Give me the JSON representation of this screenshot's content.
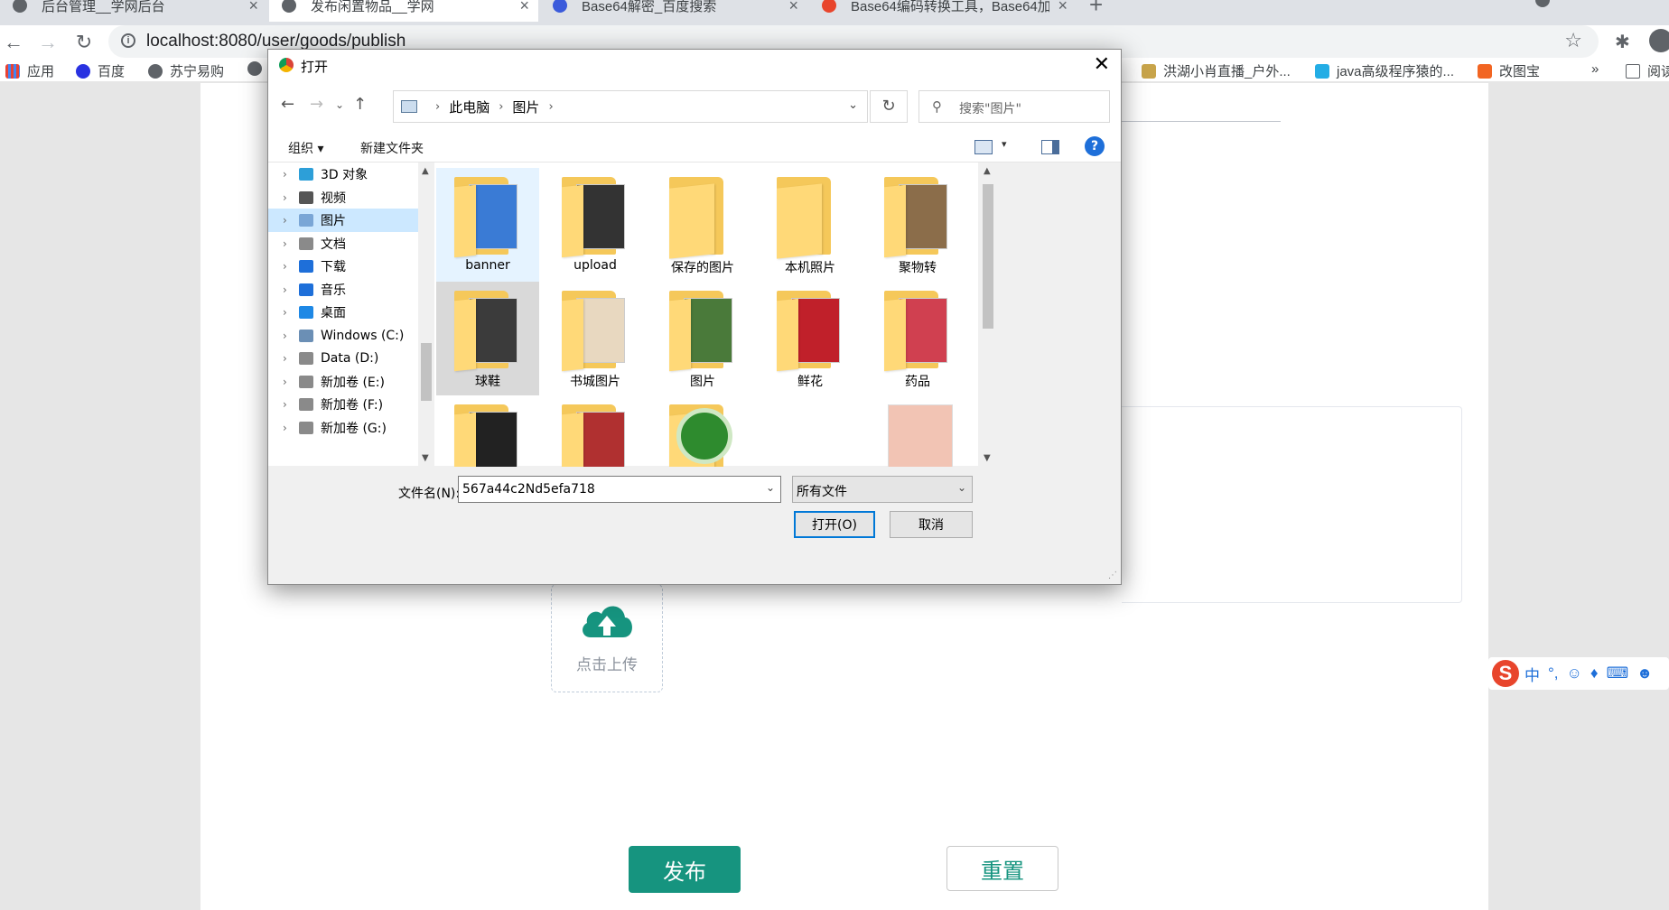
{
  "browser": {
    "tabs": [
      {
        "title": "后台管理__学网后台",
        "active": false
      },
      {
        "title": "发布闲置物品__学网",
        "active": true
      },
      {
        "title": "Base64解密_百度搜索",
        "active": false
      },
      {
        "title": "Base64编码转换工具，Base64加",
        "active": false
      }
    ],
    "url": "localhost:8080/user/goods/publish",
    "bookmarks": [
      {
        "label": "应用",
        "icon": "apps-grid-icon"
      },
      {
        "label": "百度",
        "icon": "baidu-icon"
      },
      {
        "label": "苏宁易购",
        "icon": "globe-icon"
      },
      {
        "label": "",
        "icon": "globe-icon"
      },
      {
        "label": "洪湖小肖直播_户外...",
        "icon": "bird-icon"
      },
      {
        "label": "java高级程序猿的...",
        "icon": "bilibili-icon"
      },
      {
        "label": "改图宝",
        "icon": "orange-square-icon"
      },
      {
        "label": "»",
        "icon": ""
      },
      {
        "label": "阅读",
        "icon": "reading-list-icon"
      }
    ]
  },
  "page": {
    "upload_text": "点击上传",
    "publish_label": "发布",
    "reset_label": "重置"
  },
  "ime": {
    "mode": "中",
    "punct": "°,"
  },
  "dialog": {
    "title": "打开",
    "breadcrumb": [
      "此电脑",
      "图片"
    ],
    "search_placeholder": "搜索\"图片\"",
    "organize_label": "组织",
    "new_folder_label": "新建文件夹",
    "tree": [
      {
        "label": "3D 对象",
        "icon": "3d-objects-icon",
        "color": "#2d9fd8"
      },
      {
        "label": "视频",
        "icon": "video-folder-icon",
        "color": "#555555"
      },
      {
        "label": "图片",
        "icon": "pictures-folder-icon",
        "color": "#7aa6d6",
        "selected": true
      },
      {
        "label": "文档",
        "icon": "documents-folder-icon",
        "color": "#8a8a8a"
      },
      {
        "label": "下载",
        "icon": "download-arrow-icon",
        "color": "#1e6fd9"
      },
      {
        "label": "音乐",
        "icon": "music-note-icon",
        "color": "#1e6fd9"
      },
      {
        "label": "桌面",
        "icon": "desktop-folder-icon",
        "color": "#1e88e5"
      },
      {
        "label": "Windows (C:)",
        "icon": "windows-drive-icon",
        "color": "#6b8fb5"
      },
      {
        "label": "Data (D:)",
        "icon": "drive-icon",
        "color": "#8a8a8a"
      },
      {
        "label": "新加卷 (E:)",
        "icon": "drive-icon",
        "color": "#8a8a8a"
      },
      {
        "label": "新加卷 (F:)",
        "icon": "drive-icon",
        "color": "#8a8a8a"
      },
      {
        "label": "新加卷 (G:)",
        "icon": "drive-icon",
        "color": "#8a8a8a"
      }
    ],
    "files": [
      {
        "name": "banner",
        "state": "hover",
        "preview": "#3a7bd5"
      },
      {
        "name": "upload",
        "state": "",
        "preview": "#333333"
      },
      {
        "name": "保存的图片",
        "state": "",
        "preview": ""
      },
      {
        "name": "本机照片",
        "state": "",
        "preview": ""
      },
      {
        "name": "聚物转",
        "state": "",
        "preview": "#8b6d4a"
      },
      {
        "name": "球鞋",
        "state": "pressed",
        "preview": "#3b3b3b"
      },
      {
        "name": "书城图片",
        "state": "",
        "preview": "#e8d8c0"
      },
      {
        "name": "图片",
        "state": "",
        "preview": "#4a7a3a"
      },
      {
        "name": "鲜花",
        "state": "",
        "preview": "#c0202a"
      },
      {
        "name": "药品",
        "state": "",
        "preview": "#d04050"
      },
      {
        "name": "",
        "state": "",
        "preview": "#222222"
      },
      {
        "name": "",
        "state": "",
        "preview": "#b03030"
      },
      {
        "name": "",
        "state": "",
        "preview": "#2e8b2e",
        "kind": "green-badge"
      },
      {
        "name": "",
        "state": "",
        "preview": "",
        "kind": "empty"
      },
      {
        "name": "",
        "state": "",
        "preview": "#f2c4b4",
        "kind": "photo"
      }
    ],
    "filename_label": "文件名(N):",
    "filename_value": "567a44c2Nd5efa718",
    "filetype_value": "所有文件",
    "open_label": "打开(O)",
    "cancel_label": "取消"
  }
}
